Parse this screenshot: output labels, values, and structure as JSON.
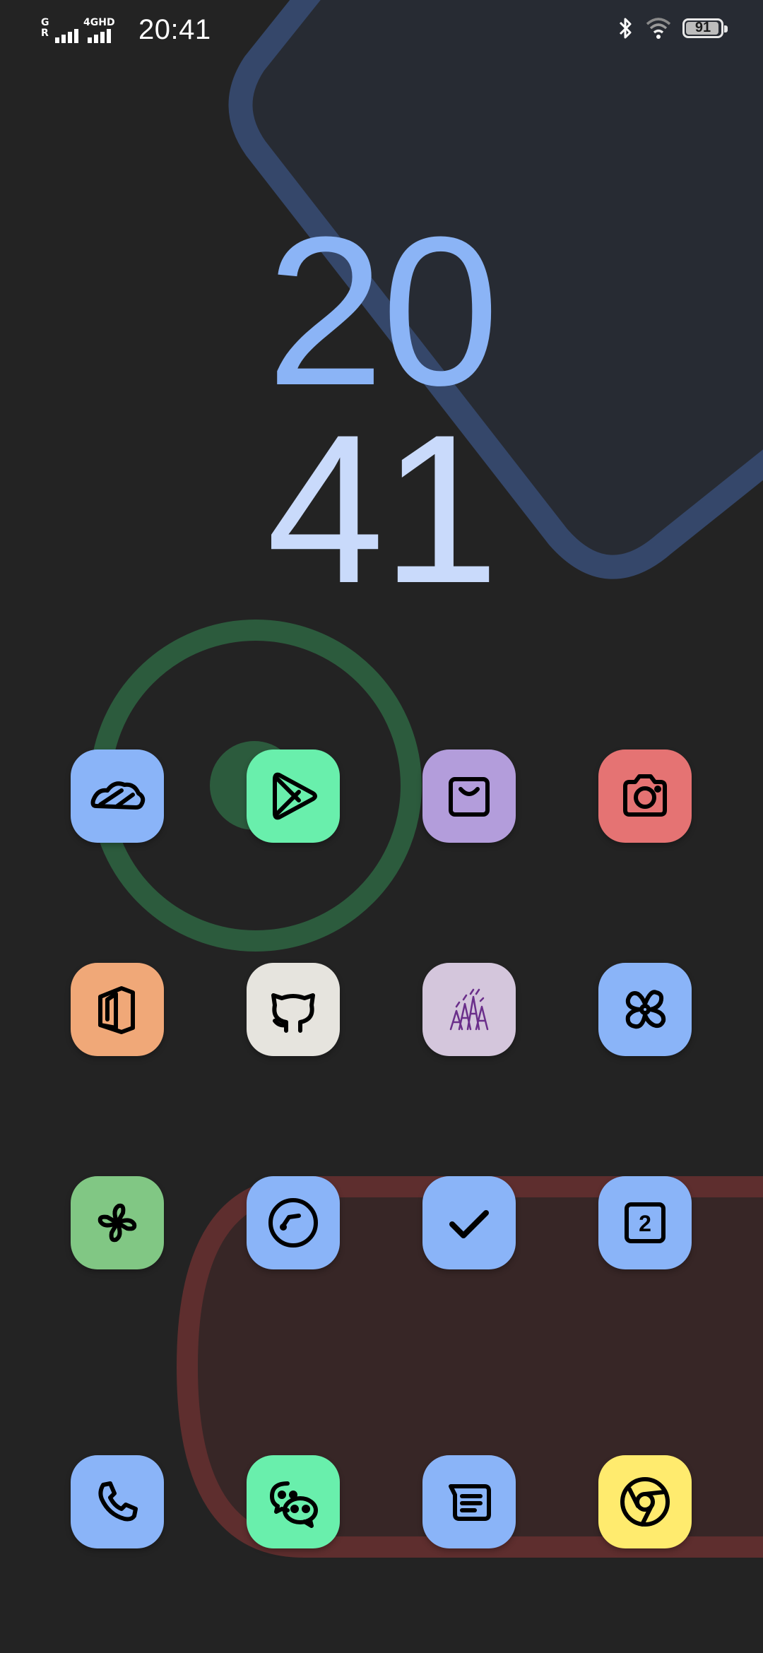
{
  "status_bar": {
    "sim1_label_top": "G",
    "sim1_label_bottom": "R",
    "sim2_label": "4GHD",
    "time": "20:41",
    "battery_level": "91",
    "icons": [
      "bluetooth-icon",
      "wifi-icon",
      "battery-icon"
    ]
  },
  "clock": {
    "hours": "20",
    "minutes": "41"
  },
  "colors": {
    "background": "#232323",
    "hours": "#8bb4f6",
    "minutes": "#c9dafb",
    "blue_icon": "#8ab4f8",
    "green_icon": "#69efac",
    "purple_icon": "#b39ddb",
    "red_icon": "#e57373",
    "orange_icon": "#f0a878",
    "white_icon": "#e6e4de",
    "lilac_icon": "#d4c6dc",
    "leaf_icon": "#81c784",
    "yellow_icon": "#ffeb6e"
  },
  "apps": [
    {
      "name": "cloud-app-icon",
      "color": "#8ab4f8"
    },
    {
      "name": "play-store-app-icon",
      "color": "#69efac"
    },
    {
      "name": "shop-app-icon",
      "color": "#b39ddb"
    },
    {
      "name": "camera-app-icon",
      "color": "#e57373"
    },
    {
      "name": "office-app-icon",
      "color": "#f0a878"
    },
    {
      "name": "github-app-icon",
      "color": "#e6e4de"
    },
    {
      "name": "forest-app-icon",
      "color": "#d4c6dc"
    },
    {
      "name": "tools-app-icon",
      "color": "#8ab4f8"
    },
    {
      "name": "pinwheel-app-icon",
      "color": "#81c784"
    },
    {
      "name": "speedometer-app-icon",
      "color": "#8ab4f8"
    },
    {
      "name": "tasks-app-icon",
      "color": "#8ab4f8"
    },
    {
      "name": "counter-app-icon",
      "color": "#8ab4f8",
      "label": "2"
    },
    {
      "name": "phone-app-icon",
      "color": "#8ab4f8"
    },
    {
      "name": "wechat-app-icon",
      "color": "#69efac"
    },
    {
      "name": "messages-app-icon",
      "color": "#8ab4f8"
    },
    {
      "name": "chrome-app-icon",
      "color": "#ffeb6e"
    }
  ]
}
